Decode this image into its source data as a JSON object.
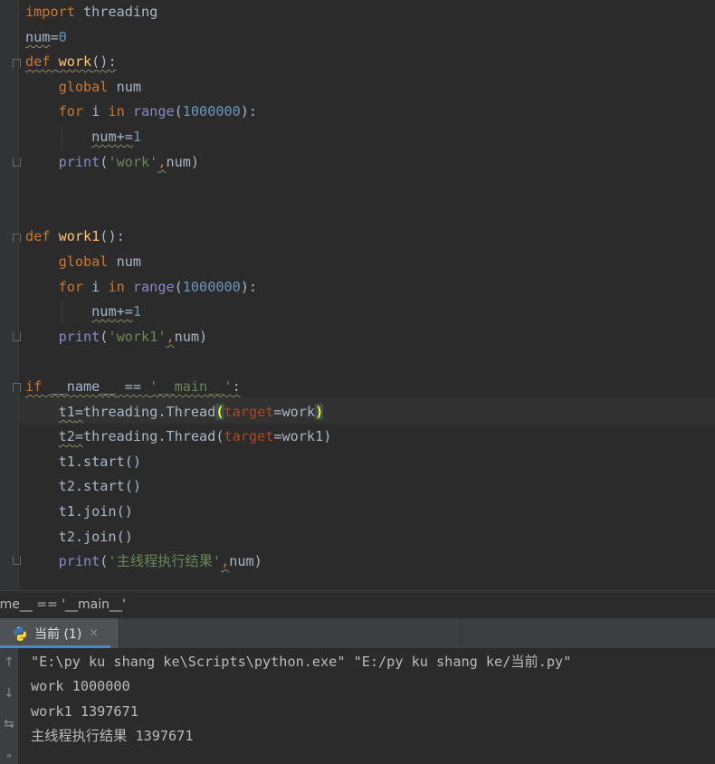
{
  "code_lines": [
    {
      "parts": [
        {
          "t": "import",
          "c": "kw"
        },
        {
          "t": " threading"
        }
      ]
    },
    {
      "parts": [
        {
          "t": "num",
          "c": "wavy"
        },
        {
          "t": "="
        },
        {
          "t": "0",
          "c": "num"
        }
      ]
    },
    {
      "parts": [
        {
          "t": "def ",
          "c": "kw wavy"
        },
        {
          "t": "work",
          "c": "fn wavy"
        },
        {
          "t": "():",
          "c": "wavy"
        }
      ]
    },
    {
      "parts": [
        {
          "t": "    "
        },
        {
          "t": "global ",
          "c": "kw"
        },
        {
          "t": "num"
        }
      ]
    },
    {
      "parts": [
        {
          "t": "    "
        },
        {
          "t": "for ",
          "c": "kw"
        },
        {
          "t": "i "
        },
        {
          "t": "in ",
          "c": "kw"
        },
        {
          "t": "range",
          "c": "bi"
        },
        {
          "t": "("
        },
        {
          "t": "1000000",
          "c": "num"
        },
        {
          "t": "):"
        }
      ]
    },
    {
      "parts": [
        {
          "t": "        "
        },
        {
          "t": "num",
          "c": "wavy"
        },
        {
          "t": "+=",
          "c": "wavy"
        },
        {
          "t": "1",
          "c": "num"
        }
      ]
    },
    {
      "parts": [
        {
          "t": "    "
        },
        {
          "t": "print",
          "c": "bi"
        },
        {
          "t": "("
        },
        {
          "t": "'work'",
          "c": "str"
        },
        {
          "t": ",",
          "c": "kw wavy"
        },
        {
          "t": "num)"
        }
      ]
    },
    {
      "parts": []
    },
    {
      "parts": []
    },
    {
      "parts": [
        {
          "t": "def ",
          "c": "kw"
        },
        {
          "t": "work1",
          "c": "fn"
        },
        {
          "t": "():"
        }
      ]
    },
    {
      "parts": [
        {
          "t": "    "
        },
        {
          "t": "global ",
          "c": "kw"
        },
        {
          "t": "num"
        }
      ]
    },
    {
      "parts": [
        {
          "t": "    "
        },
        {
          "t": "for ",
          "c": "kw"
        },
        {
          "t": "i "
        },
        {
          "t": "in ",
          "c": "kw"
        },
        {
          "t": "range",
          "c": "bi"
        },
        {
          "t": "("
        },
        {
          "t": "1000000",
          "c": "num"
        },
        {
          "t": "):"
        }
      ]
    },
    {
      "parts": [
        {
          "t": "        "
        },
        {
          "t": "num",
          "c": "wavy"
        },
        {
          "t": "+=",
          "c": "wavy"
        },
        {
          "t": "1",
          "c": "num"
        }
      ]
    },
    {
      "parts": [
        {
          "t": "    "
        },
        {
          "t": "print",
          "c": "bi"
        },
        {
          "t": "("
        },
        {
          "t": "'work1'",
          "c": "str"
        },
        {
          "t": ",",
          "c": "kw wavy"
        },
        {
          "t": "num)"
        }
      ]
    },
    {
      "parts": []
    },
    {
      "parts": [
        {
          "t": "if ",
          "c": "kw wavy"
        },
        {
          "t": "__name__",
          "c": "wavy"
        },
        {
          "t": " == ",
          "c": "wavy"
        },
        {
          "t": "'__main__'",
          "c": "str wavy"
        },
        {
          "t": ":",
          "c": "wavy"
        }
      ]
    },
    {
      "parts": [
        {
          "t": "    "
        },
        {
          "t": "t1",
          "c": "wavy"
        },
        {
          "t": "=",
          "c": "wavy"
        },
        {
          "t": "threading.Thread"
        },
        {
          "t": "(",
          "c": "brace"
        },
        {
          "t": "target",
          "c": "par"
        },
        {
          "t": "=work"
        },
        {
          "t": ")",
          "c": "brace"
        }
      ]
    },
    {
      "parts": [
        {
          "t": "    "
        },
        {
          "t": "t2",
          "c": "wavy"
        },
        {
          "t": "=",
          "c": "wavy"
        },
        {
          "t": "threading.Thread("
        },
        {
          "t": "target",
          "c": "par"
        },
        {
          "t": "=work1)"
        }
      ]
    },
    {
      "parts": [
        {
          "t": "    t1.start()"
        }
      ]
    },
    {
      "parts": [
        {
          "t": "    t2.start()"
        }
      ]
    },
    {
      "parts": [
        {
          "t": "    t1.join()"
        }
      ]
    },
    {
      "parts": [
        {
          "t": "    t2.join()"
        }
      ]
    },
    {
      "parts": [
        {
          "t": "    "
        },
        {
          "t": "print",
          "c": "bi"
        },
        {
          "t": "("
        },
        {
          "t": "'主线程执行结果'",
          "c": "str"
        },
        {
          "t": ",",
          "c": "kw wavy"
        },
        {
          "t": "num)"
        }
      ]
    }
  ],
  "breadcrumb": "ame__ == '__main__'",
  "run_tab": {
    "label": "当前 (1)",
    "close": "×"
  },
  "sidebar_icons": {
    "up": "↑",
    "down": "↓",
    "wrap": "⇆",
    "more": "»"
  },
  "console": {
    "command": "\"E:\\py ku shang ke\\Scripts\\python.exe\" \"E:/py ku shang ke/当前.py\"",
    "out1": "work 1000000",
    "out2": "work1 1397671",
    "out3": "主线程执行结果 1397671"
  }
}
